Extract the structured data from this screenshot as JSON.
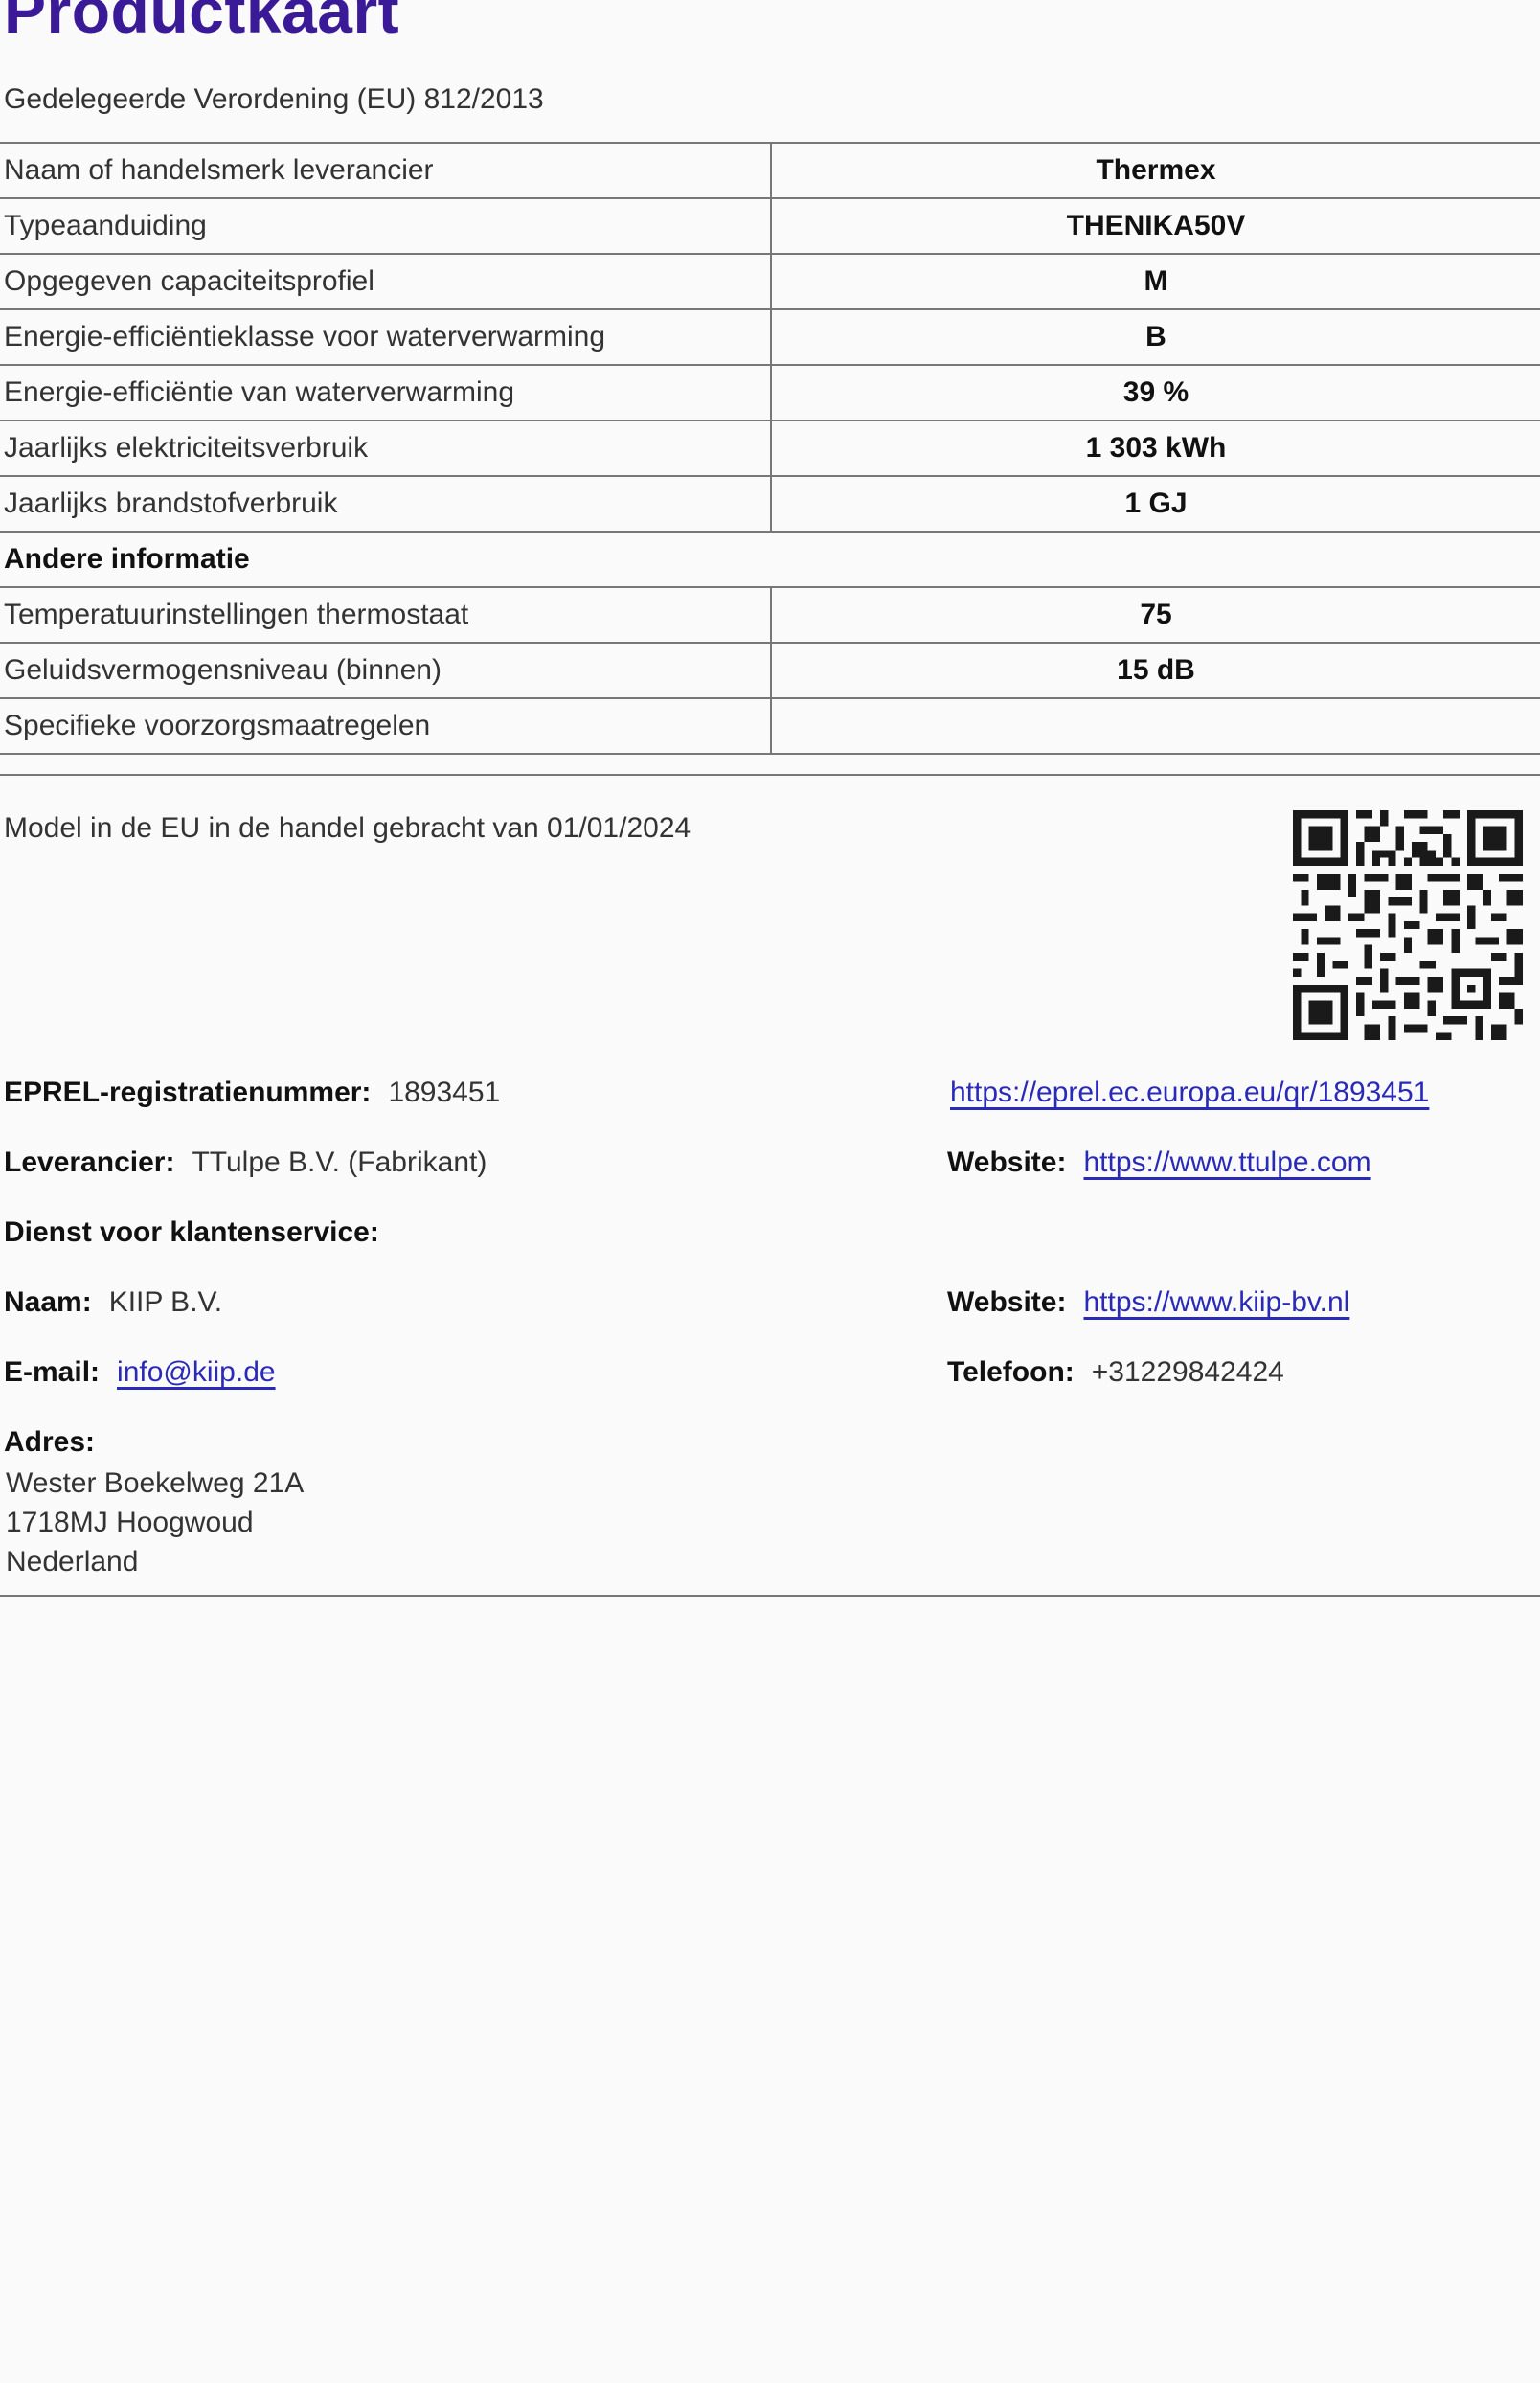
{
  "header": {
    "title": "Productkaart",
    "subtitle": "Gedelegeerde Verordening (EU) 812/2013"
  },
  "spec_rows": [
    {
      "label": "Naam of handelsmerk leverancier",
      "value": "Thermex"
    },
    {
      "label": "Typeaanduiding",
      "value": "THENIKA50V"
    },
    {
      "label": "Opgegeven capaciteitsprofiel",
      "value": "M"
    },
    {
      "label": "Energie-efficiëntieklasse voor waterverwarming",
      "value": "B"
    },
    {
      "label": "Energie-efficiëntie van waterverwarming",
      "value": "39 %"
    },
    {
      "label": "Jaarlijks elektriciteitsverbruik",
      "value": "1 303 kWh"
    },
    {
      "label": "Jaarlijks brandstofverbruik",
      "value": "1 GJ"
    }
  ],
  "other_info": {
    "heading": "Andere informatie",
    "rows": [
      {
        "label": "Temperatuurinstellingen thermostaat",
        "value": "75"
      },
      {
        "label": "Geluidsvermogensniveau (binnen)",
        "value": "15 dB"
      },
      {
        "label": "Specifieke voorzorgsmaatregelen",
        "value": ""
      }
    ]
  },
  "model": {
    "placed_on_market": "Model in de EU in de handel gebracht van 01/01/2024"
  },
  "eprel": {
    "label": "EPREL-registratienummer:",
    "number": "1893451",
    "url": "https://eprel.ec.europa.eu/qr/1893451"
  },
  "supplier": {
    "label": "Leverancier:",
    "value": "TTulpe B.V. (Fabrikant)",
    "website_label": "Website:",
    "website": "https://www.ttulpe.com"
  },
  "customer_service": {
    "heading": "Dienst voor klantenservice:",
    "name_label": "Naam:",
    "name": "KIIP B.V.",
    "website_label": "Website:",
    "website": "https://www.kiip-bv.nl",
    "email_label": "E-mail:",
    "email": "info@kiip.de",
    "phone_label": "Telefoon:",
    "phone": "+31229842424",
    "address_label": "Adres:",
    "address_lines": [
      "Wester Boekelweg 21A",
      "1718MJ Hoogwoud",
      "Nederland"
    ]
  },
  "qr_code": {
    "icon": "qr-code-icon"
  }
}
